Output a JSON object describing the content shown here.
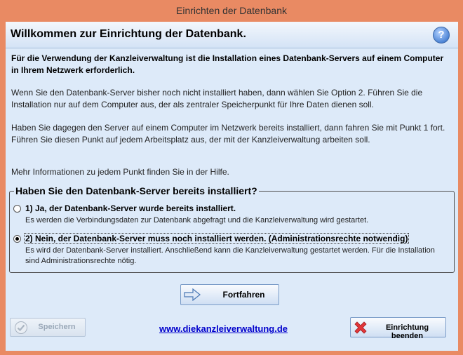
{
  "window": {
    "title": "Einrichten der Datenbank"
  },
  "header": {
    "title": "Willkommen zur Einrichtung der Datenbank.",
    "help_symbol": "?"
  },
  "content": {
    "intro": "Für die Verwendung der Kanzleiverwaltung ist die Installation eines Datenbank-Servers auf einem Computer in Ihrem Netzwerk erforderlich.",
    "paragraph1": "Wenn Sie den Datenbank-Server bisher noch nicht installiert haben, dann wählen Sie Option 2. Führen Sie die Installation nur auf dem Computer aus, der als zentraler Speicherpunkt für Ihre Daten dienen soll.",
    "paragraph2": "Haben Sie dagegen den Server auf einem Computer im Netzwerk bereits installiert, dann fahren Sie mit Punkt 1 fort. Führen Sie diesen Punkt auf jedem Arbeitsplatz aus, der mit der Kanzleiverwaltung arbeiten soll.",
    "paragraph3": "Mehr Informationen zu jedem Punkt finden Sie in der Hilfe."
  },
  "options": {
    "legend": "Haben Sie den Datenbank-Server bereits installiert?",
    "items": [
      {
        "label": "1) Ja, der Datenbank-Server wurde bereits installiert.",
        "description": "Es werden die Verbindungsdaten zur Datenbank abgefragt und die Kanzleiverwaltung wird gestartet.",
        "selected": false
      },
      {
        "label": "2) Nein, der Datenbank-Server muss noch installiert werden. (Administrationsrechte notwendig)",
        "description": "Es wird der Datenbank-Server installiert. Anschließend kann die Kanzleiverwaltung gestartet werden. Für die Installation sind Administrationsrechte nötig.",
        "selected": true
      }
    ]
  },
  "buttons": {
    "continue": "Fortfahren",
    "save": "Speichern",
    "end_setup": "Einrichtung beenden"
  },
  "footer": {
    "link": "www.diekanzleiverwaltung.de"
  },
  "colors": {
    "window_frame": "#e98a63",
    "client_background": "#ddeaf9",
    "link": "#0000cc"
  },
  "icons": {
    "help": "help-icon",
    "continue": "arrow-right-icon",
    "save": "checkmark-circle-icon",
    "end_setup": "red-x-icon"
  }
}
